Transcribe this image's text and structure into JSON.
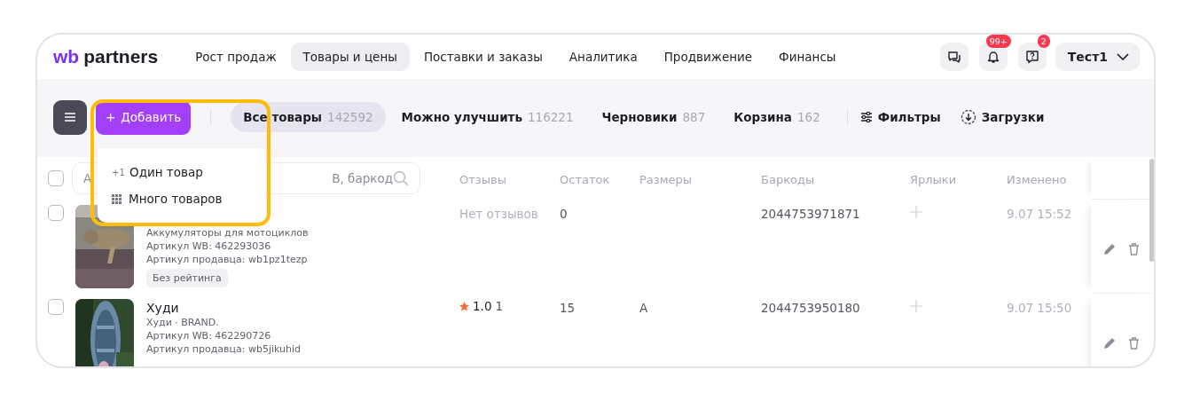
{
  "logo": {
    "mark": "wb",
    "text": "partners"
  },
  "nav": [
    {
      "label": "Рост продаж",
      "selected": false
    },
    {
      "label": "Товары и цены",
      "selected": true
    },
    {
      "label": "Поставки и заказы",
      "selected": false
    },
    {
      "label": "Аналитика",
      "selected": false
    },
    {
      "label": "Продвижение",
      "selected": false
    },
    {
      "label": "Финансы",
      "selected": false
    }
  ],
  "header_buttons": [
    {
      "kind": "chat"
    },
    {
      "kind": "bell",
      "badge": "99+"
    },
    {
      "kind": "help",
      "badge": "2"
    }
  ],
  "user": {
    "name": "Тест1"
  },
  "add_button": {
    "icon": "+",
    "label": "Добавить"
  },
  "tabs": [
    {
      "label": "Все товары",
      "count": "142592",
      "selected": true
    },
    {
      "label": "Можно улучшить",
      "count": "116221",
      "selected": false
    },
    {
      "label": "Черновики",
      "count": "887",
      "selected": false
    },
    {
      "label": "Корзина",
      "count": "162",
      "selected": false
    }
  ],
  "tools": [
    {
      "kind": "filters",
      "label": "Фильтры"
    },
    {
      "kind": "downloads",
      "label": "Загрузки"
    }
  ],
  "add_menu": {
    "items": [
      {
        "kind": "one",
        "icon": "+1",
        "label": "Один товар"
      },
      {
        "kind": "many",
        "label": "Много товаров"
      }
    ]
  },
  "select_all": {
    "checked": false
  },
  "search": {
    "placeholder_start": "А",
    "placeholder_end": "В, баркод"
  },
  "columns": [
    "Отзывы",
    "Остаток",
    "Размеры",
    "Баркоды",
    "Ярлыки",
    "Изменено"
  ],
  "rows": [
    {
      "checked": false,
      "details": [
        "Аккумуляторы для мотоциклов",
        "Артикул WB: 462293036",
        "Артикул продавца: wb1pz1tezp"
      ],
      "tag": "Без рейтинга",
      "reviews": {
        "kind": "none",
        "text": "Нет отзывов"
      },
      "stock": "0",
      "barcode": "2044753971871",
      "changed": "9.07 15:52"
    },
    {
      "checked": false,
      "title": "Худи",
      "details": [
        "Худи · BRAND.",
        "Артикул WB: 462290726",
        "Артикул продавца: wb5jikuhid"
      ],
      "reviews": {
        "kind": "rating",
        "score": "1.0",
        "count": "1"
      },
      "stock": "15",
      "size": "A",
      "barcode": "2044753950180",
      "changed": "9.07 15:50"
    }
  ]
}
